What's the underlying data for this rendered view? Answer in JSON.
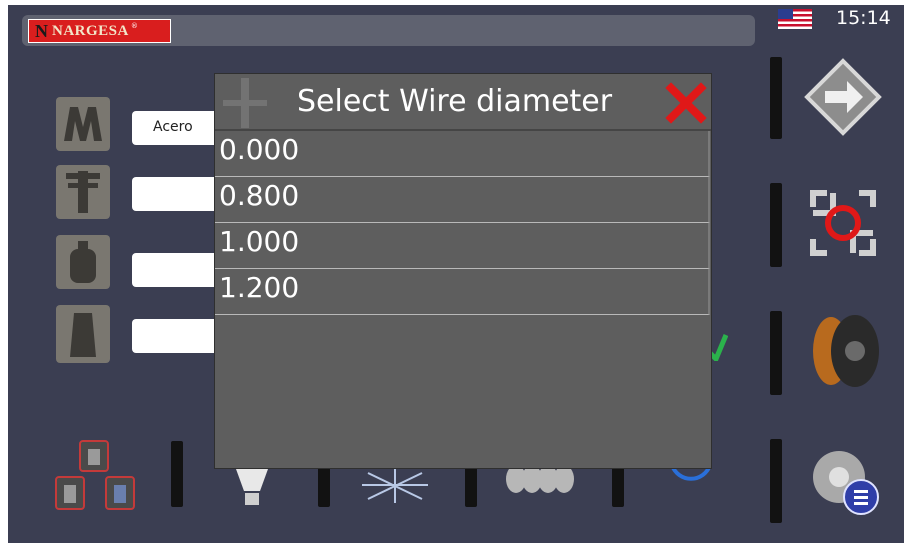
{
  "brand": {
    "logo_mark": "N",
    "logo_text": "NARGESA",
    "logo_reg": "®"
  },
  "status": {
    "clock": "15:14",
    "language_flag": "us-flag-icon"
  },
  "params": {
    "material_value": "Acero"
  },
  "dialog": {
    "title": "Select Wire diameter",
    "options": [
      "0.000",
      "0.800",
      "1.000",
      "1.200"
    ]
  },
  "colors": {
    "background": "#3b3e52",
    "dialog": "#5e5e5e",
    "close": "#e01818",
    "logo": "#d91e1e"
  }
}
